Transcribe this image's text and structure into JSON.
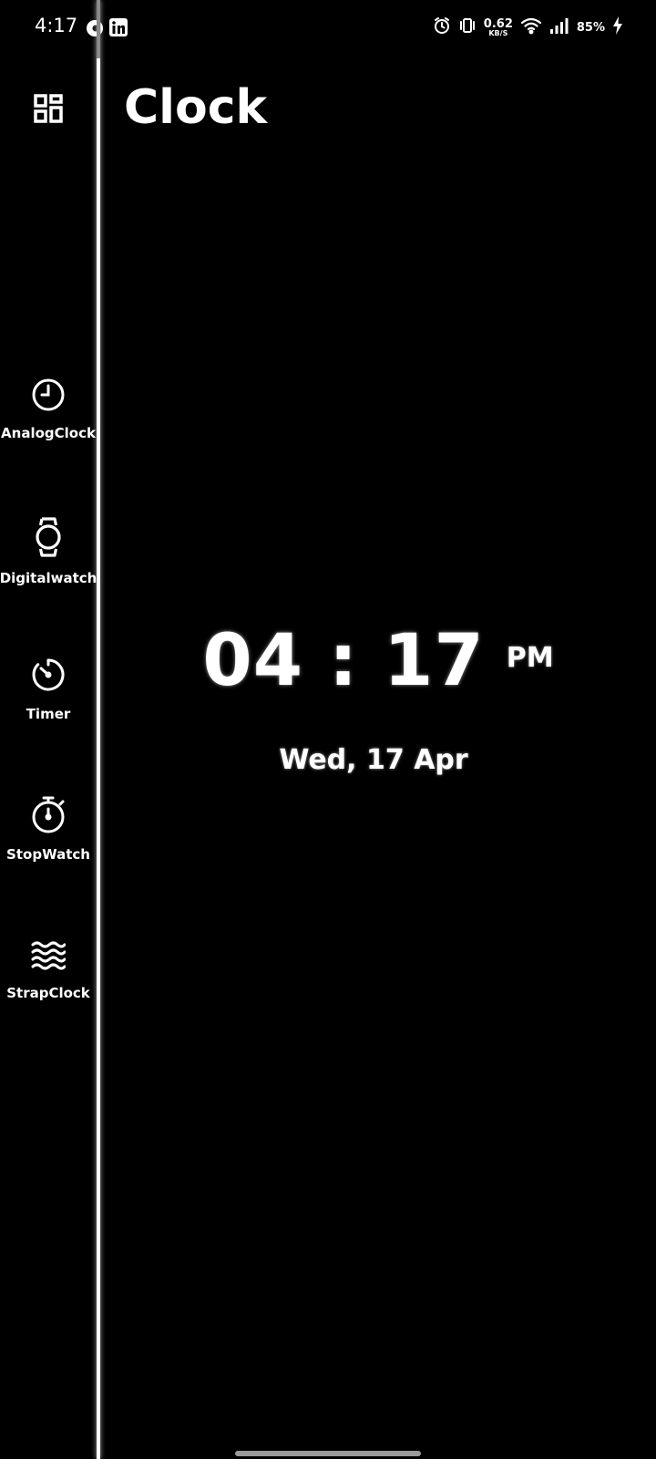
{
  "status_bar": {
    "time": "4:17",
    "net_speed_value": "0.62",
    "net_speed_unit": "KB/S",
    "battery_percent": "85%",
    "icons": [
      "threads-icon",
      "linkedin-icon",
      "alarm-icon",
      "vibrate-icon",
      "wifi-icon",
      "signal-icon",
      "charging-icon"
    ]
  },
  "app": {
    "title": "Clock"
  },
  "sidebar": {
    "menu_icon": "dashboard-icon",
    "items": [
      {
        "label": "AnalogClock",
        "icon": "analog-clock-icon"
      },
      {
        "label": "Digitalwatch",
        "icon": "watch-icon"
      },
      {
        "label": "Timer",
        "icon": "timer-icon"
      },
      {
        "label": "StopWatch",
        "icon": "stopwatch-icon"
      },
      {
        "label": "StrapClock",
        "icon": "waves-icon"
      }
    ]
  },
  "clock": {
    "hours": "04",
    "separator": ":",
    "minutes": "17",
    "ampm": "PM",
    "date": "Wed, 17 Apr"
  },
  "colors": {
    "background": "#000000",
    "foreground": "#ffffff"
  }
}
